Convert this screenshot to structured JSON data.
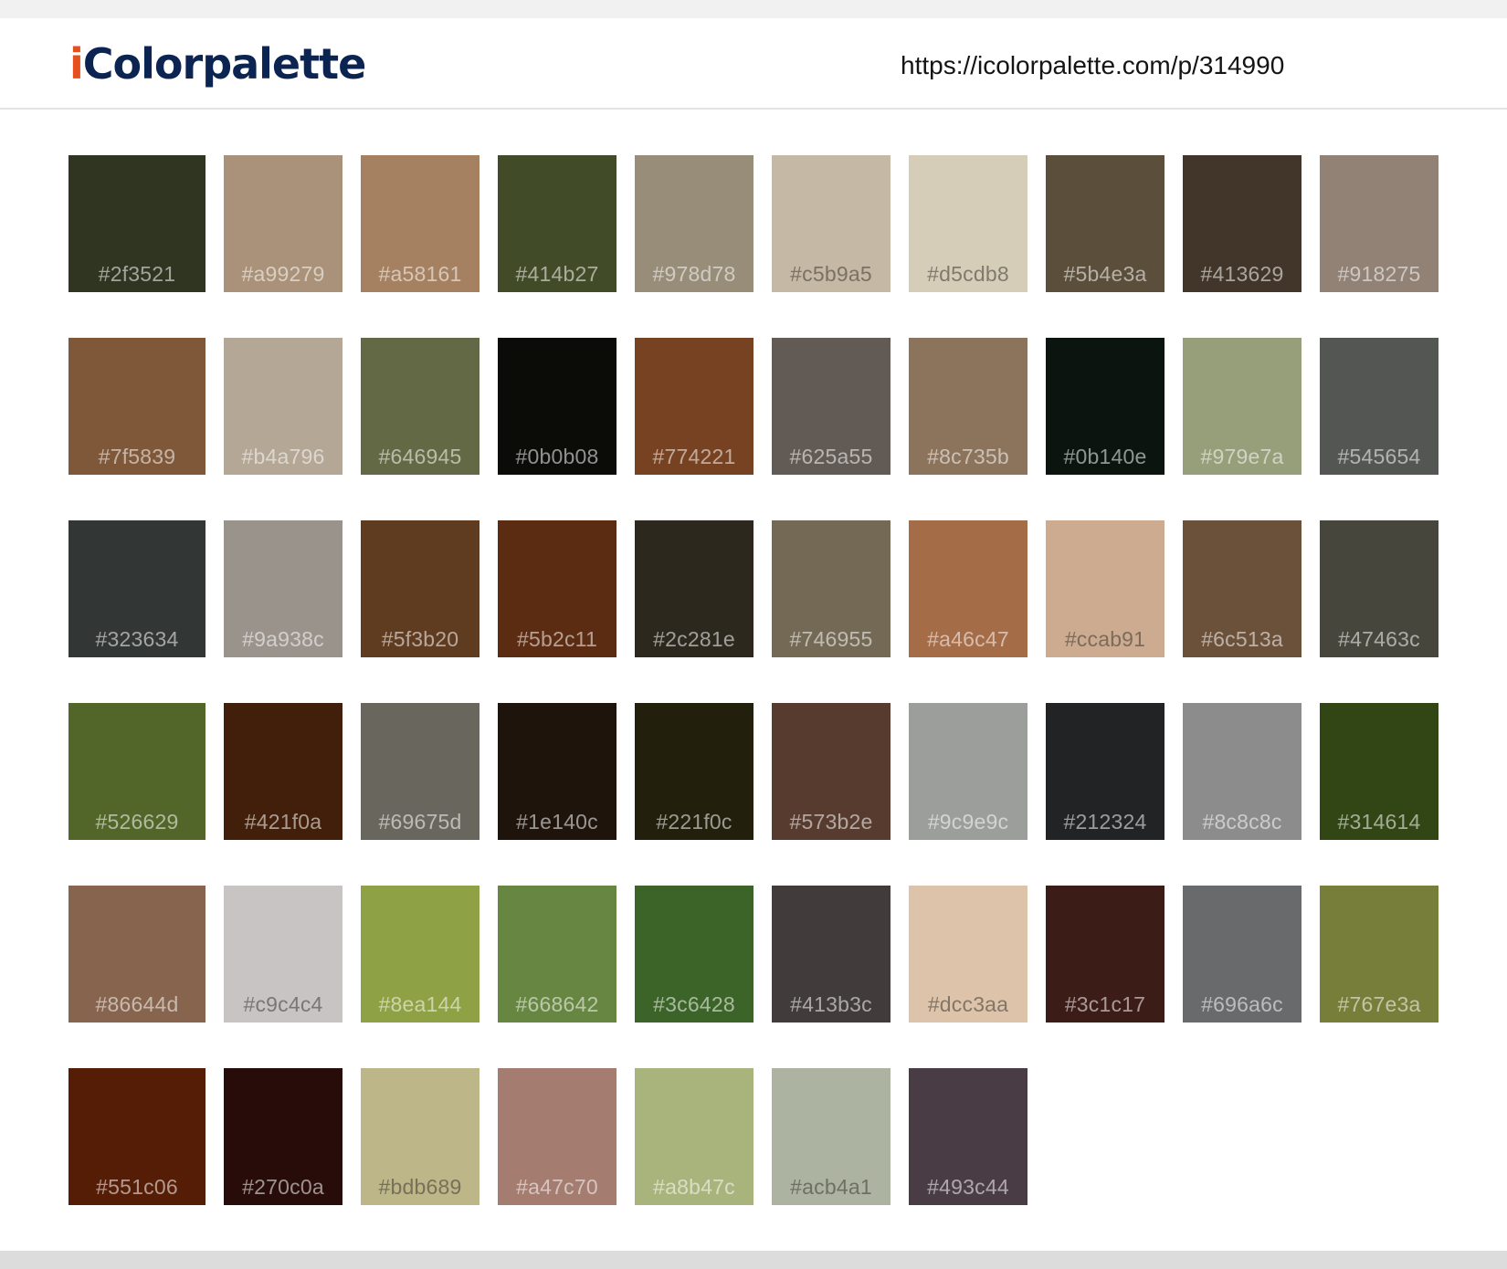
{
  "header": {
    "logo_i": "i",
    "logo_rest": "Colorpalette",
    "url": "https://icolorpalette.com/p/314990"
  },
  "colors": [
    "#2f3521",
    "#a99279",
    "#a58161",
    "#414b27",
    "#978d78",
    "#c5b9a5",
    "#d5cdb8",
    "#5b4e3a",
    "#413629",
    "#918275",
    "#7f5839",
    "#b4a796",
    "#646945",
    "#0b0b08",
    "#774221",
    "#625a55",
    "#8c735b",
    "#0b140e",
    "#979e7a",
    "#545654",
    "#323634",
    "#9a938c",
    "#5f3b20",
    "#5b2c11",
    "#2c281e",
    "#746955",
    "#a46c47",
    "#ccab91",
    "#6c513a",
    "#47463c",
    "#526629",
    "#421f0a",
    "#69675d",
    "#1e140c",
    "#221f0c",
    "#573b2e",
    "#9c9e9c",
    "#212324",
    "#8c8c8c",
    "#314614",
    "#86644d",
    "#c9c4c4",
    "#8ea144",
    "#668642",
    "#3c6428",
    "#413b3c",
    "#dcc3aa",
    "#3c1c17",
    "#696a6c",
    "#767e3a",
    "#551c06",
    "#270c0a",
    "#bdb689",
    "#a47c70",
    "#a8b47c",
    "#acb4a1",
    "#493c44"
  ]
}
